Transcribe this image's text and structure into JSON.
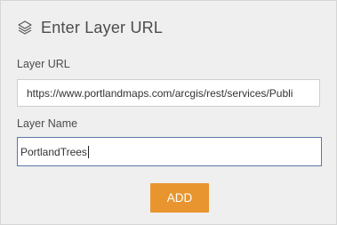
{
  "header": {
    "title": "Enter Layer URL",
    "icon": "layers-icon"
  },
  "layer_url": {
    "label": "Layer URL",
    "value": "https://www.portlandmaps.com/arcgis/rest/services/Publi"
  },
  "layer_name": {
    "label": "Layer Name",
    "value": "PortlandTrees"
  },
  "actions": {
    "add_label": "ADD"
  },
  "colors": {
    "accent": "#e8952f",
    "focus_border": "#5a78a8",
    "panel_bg": "#efefef"
  }
}
